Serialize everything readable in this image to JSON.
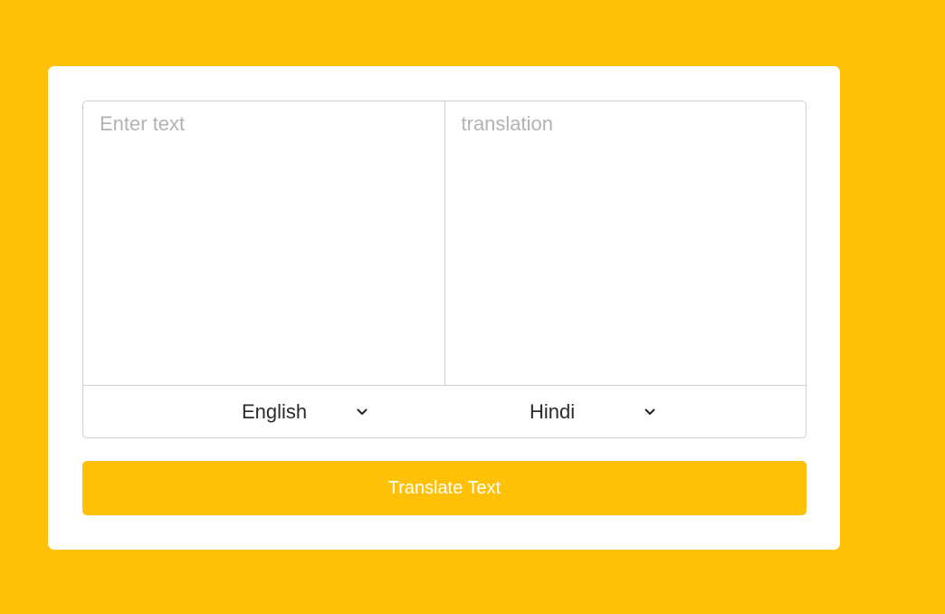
{
  "translator": {
    "source_text": {
      "value": "",
      "placeholder": "Enter text"
    },
    "target_text": {
      "value": "",
      "placeholder": "translation"
    },
    "source_language": {
      "selected": "English",
      "icon": "chevron-down-icon"
    },
    "target_language": {
      "selected": "Hindi",
      "icon": "chevron-down-icon"
    },
    "translate_button_label": "Translate Text"
  },
  "colors": {
    "background": "#FFC107",
    "card": "#FFFFFF",
    "button": "#FFC107",
    "button_text": "#FFFFFF",
    "placeholder": "#B3B3B3",
    "border": "#CFCFCF"
  }
}
